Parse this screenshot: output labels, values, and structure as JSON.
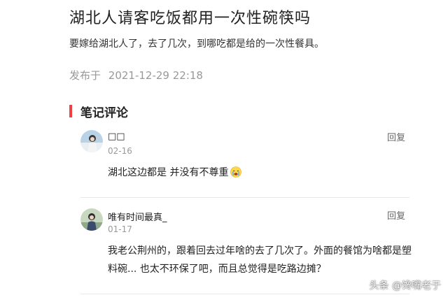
{
  "article": {
    "title": "湖北人请客吃饭都用一次性碗筷吗",
    "description": "要嫁给湖北人了，去了几次，到哪吃都是给的一次性餐具。",
    "publish_label": "发布于",
    "publish_time": "2021-12-29 22:18"
  },
  "comments_section": {
    "title": "笔记评论",
    "accent_color": "#f04142"
  },
  "comments": [
    {
      "name": "□□",
      "date": "02-16",
      "reply_label": "回复",
      "text": "湖北这边都是 并没有不尊重",
      "emoji": "crying-face-icon"
    },
    {
      "name": "唯有时间最真_",
      "date": "01-17",
      "reply_label": "回复",
      "text_lines": [
        "我老公荆州的，跟着回去过年啥的去了几次了。外面的餐馆为啥都是塑",
        "料碗... 也太不环保了吧，而且总觉得是吃路边摊？"
      ]
    }
  ],
  "watermark": "头条 @馋嘴老于"
}
